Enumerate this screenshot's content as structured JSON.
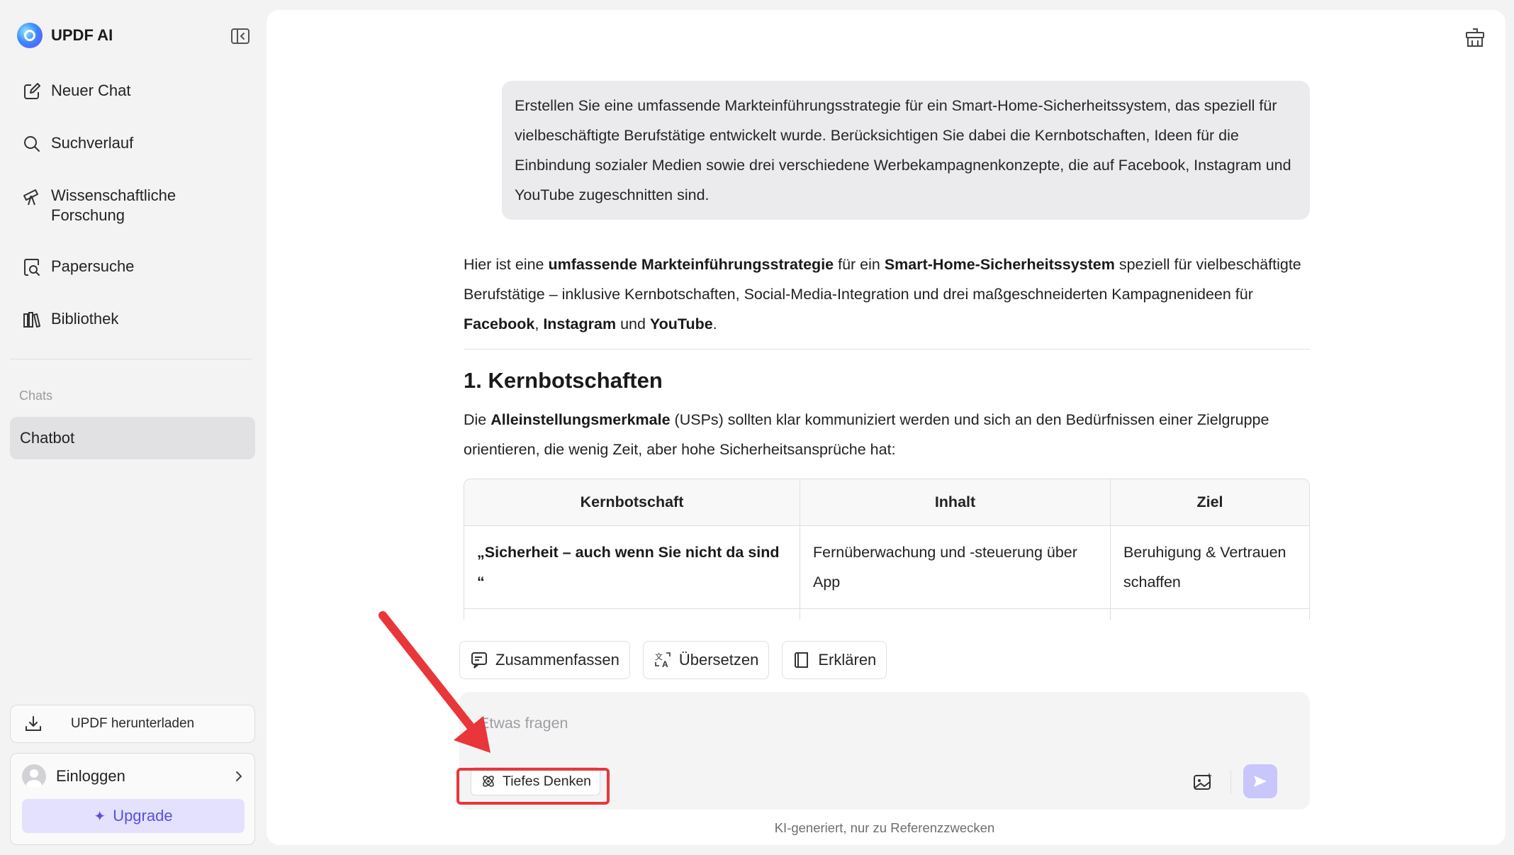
{
  "app": {
    "name": "UPDF AI"
  },
  "sidebar": {
    "nav": [
      {
        "label": "Neuer Chat",
        "icon": "new-chat-icon"
      },
      {
        "label": "Suchverlauf",
        "icon": "search-icon"
      },
      {
        "label": "Wissenschaftliche\nForschung",
        "icon": "telescope-icon"
      },
      {
        "label": "Papersuche",
        "icon": "paper-search-icon"
      },
      {
        "label": "Bibliothek",
        "icon": "library-icon"
      }
    ],
    "chats_heading": "Chats",
    "chats": [
      {
        "label": "Chatbot",
        "active": true
      }
    ],
    "download_label": "UPDF herunterladen",
    "login_label": "Einloggen",
    "upgrade_label": "Upgrade"
  },
  "conversation": {
    "user_message": "Erstellen Sie eine umfassende Markteinführungsstrategie für ein Smart-Home-Sicherheitssystem, das speziell für vielbeschäftigte Berufstätige entwickelt wurde. Berücksichtigen Sie dabei die Kernbotschaften, Ideen für die Einbindung sozialer Medien sowie drei verschiedene Werbekampagnenkonzepte, die auf Facebook, Instagram und YouTube zugeschnitten sind.",
    "answer": {
      "intro": {
        "t1": "Hier ist eine ",
        "b1": "umfassende Markteinführungsstrategie",
        "t2": " für ein ",
        "b2": "Smart-Home-Sicherheitssystem",
        "t3": " speziell für vielbeschäftigte Berufstätige – inklusive Kernbotschaften, Social-Media-Integration und drei maßgeschneiderten Kampagnenideen für ",
        "b3": "Facebook",
        "t4": ", ",
        "b4": "Instagram",
        "t5": " und ",
        "b5": "YouTube",
        "t6": "."
      },
      "section_title": "1. Kernbotschaften",
      "section_text": {
        "t1": "Die ",
        "b1": "Alleinstellungsmerkmale",
        "t2": " (USPs) sollten klar kommuniziert werden und sich an den Bedürfnissen einer Zielgruppe orientieren, die wenig Zeit, aber hohe Sicherheitsansprüche hat:"
      },
      "table": {
        "headers": [
          "Kernbotschaft",
          "Inhalt",
          "Ziel"
        ],
        "rows": [
          [
            "„Sicherheit – auch wenn Sie nicht da sind “",
            "Fernüberwachung und -steuerung über App",
            "Beruhigung & Vertrauen schaffen"
          ]
        ]
      }
    }
  },
  "quick_actions": [
    {
      "label": "Zusammenfassen",
      "icon": "summarize-icon"
    },
    {
      "label": "Übersetzen",
      "icon": "translate-icon"
    },
    {
      "label": "Erklären",
      "icon": "book-icon"
    }
  ],
  "composer": {
    "placeholder": "Etwas fragen",
    "deep_think_label": "Tiefes Denken"
  },
  "disclaimer": "KI-generiert, nur zu Referenzzwecken",
  "colors": {
    "accent": "#5a4fe0",
    "send_button": "#c9c6fb",
    "annotation": "#e8363a"
  }
}
